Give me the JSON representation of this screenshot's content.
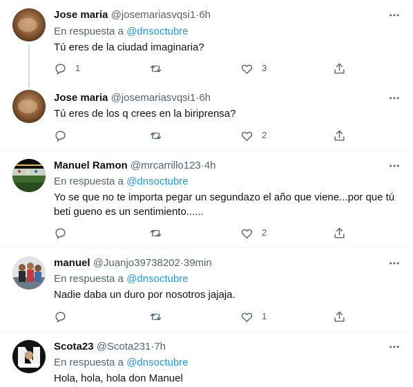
{
  "reply_prefix": "En respuesta a",
  "tweets": [
    {
      "name": "Jose maria",
      "handle": "@josemariasvqsi1",
      "time": "6h",
      "reply_to": "@dnsoctubre",
      "text": "Tú eres de la ciudad imaginaria?",
      "replies": "1",
      "retweets": "",
      "likes": "3"
    },
    {
      "name": "Jose maria",
      "handle": "@josemariasvqsi1",
      "time": "6h",
      "text": "Tú eres de los q crees en la biriprensa?",
      "replies": "",
      "retweets": "",
      "likes": "2"
    },
    {
      "name": "Manuel Ramon",
      "handle": "@mrcarrillo123",
      "time": "4h",
      "reply_to": "@dnsoctubre",
      "text_line1": "Yo se que no te importa pegar un segundazo el año que viene...por que tú",
      "text_line2": "beti gueno es un sentimiento......",
      "replies": "",
      "retweets": "",
      "likes": "2"
    },
    {
      "name": "manuel",
      "handle": "@Juanjo39738202",
      "time": "39min",
      "reply_to": "@dnsoctubre",
      "text": "Nadie daba un duro por nosotros jajaja.",
      "replies": "",
      "retweets": "",
      "likes": "1"
    },
    {
      "name": "Scota23",
      "handle": "@Scota231",
      "time": "7h",
      "reply_to": "@dnsoctubre",
      "text": "Hola, hola, hola don Manuel"
    }
  ],
  "dot": "·",
  "icons": {
    "reply": "reply-icon",
    "retweet": "retweet-icon",
    "like": "heart-icon",
    "share": "share-icon",
    "more": "more-icon"
  },
  "colors": {
    "text": "#0f1419",
    "secondary": "#536471",
    "accent": "#1d9bf0",
    "divider": "#eff3f4"
  }
}
